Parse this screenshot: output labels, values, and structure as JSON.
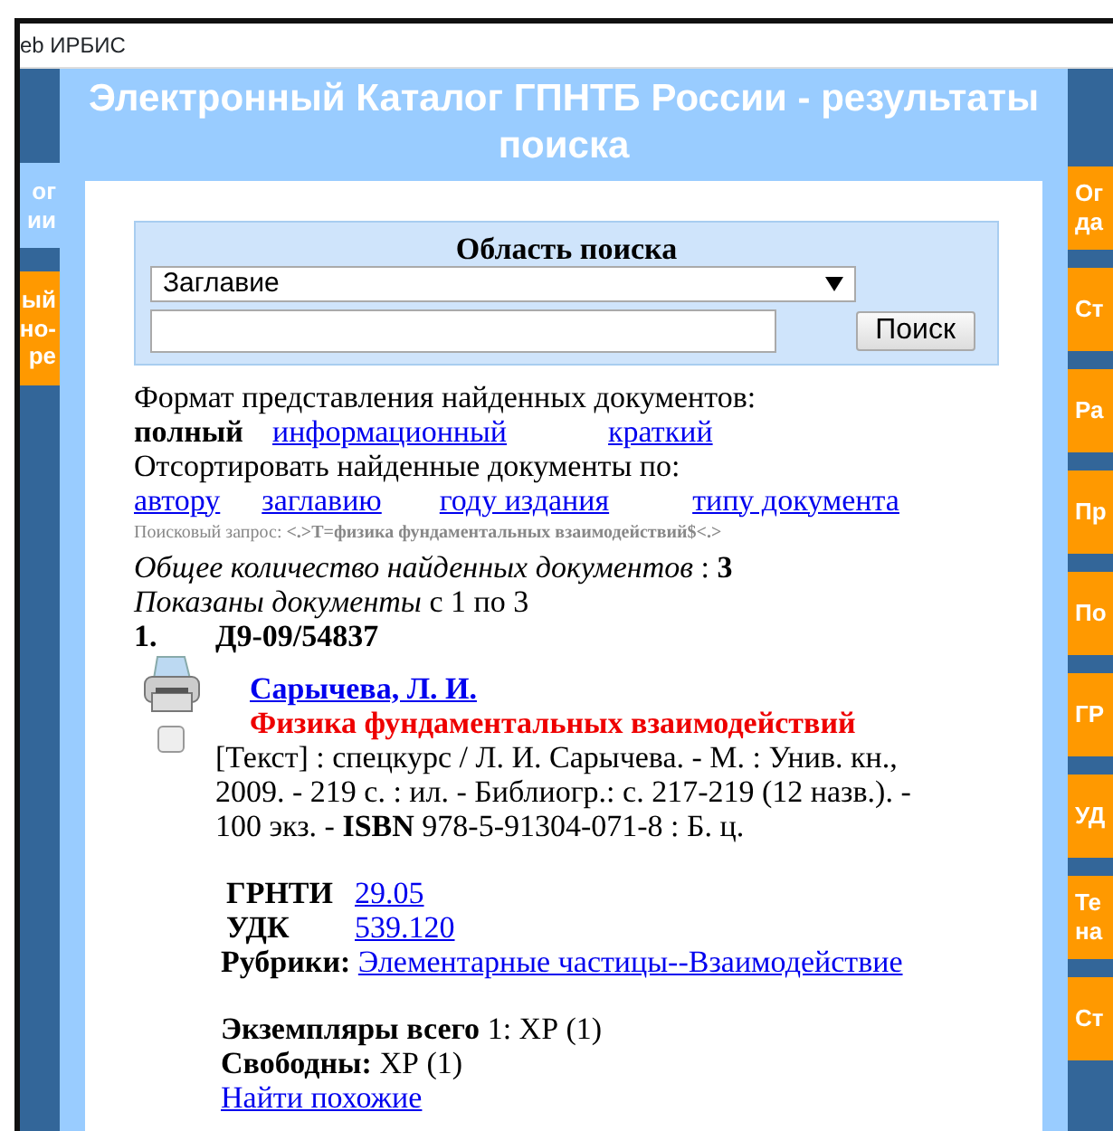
{
  "window": {
    "title": "eb ИРБИС"
  },
  "left_nav": [
    {
      "lines": [
        "ог",
        "ии"
      ],
      "kind": "current"
    },
    {
      "lines": [
        "ый",
        "но-",
        "ре"
      ],
      "kind": "link"
    }
  ],
  "header": {
    "title": "Электронный Каталог ГПНТБ России - результаты поиска"
  },
  "search": {
    "label": "Область поиска",
    "field": "Заглавие",
    "button": "Поиск"
  },
  "format": {
    "label": "Формат представления найденных документов:",
    "options": [
      {
        "text": "полный",
        "selected": true
      },
      {
        "text": "информационный",
        "selected": false
      },
      {
        "text": "краткий",
        "selected": false
      }
    ]
  },
  "sort": {
    "label": "Отсортировать найденные документы по:",
    "options": [
      "автору",
      "заглавию",
      "году издания",
      "типу документа"
    ]
  },
  "query": "Поисковый запрос: **<.>T=физика фундаментальных взаимодействий$<.>**",
  "total": "*Общее количество найденных документов* : **3**",
  "shown": "*Показаны документы* с 1 по 3",
  "records": [
    {
      "number": "1.",
      "code": "Д9-09/54837",
      "checked": false,
      "author": "Сарычева, Л. И.",
      "title": "Физика фундаментальных взаимодействий",
      "description": "[Текст] : спецкурс / Л. И. Сарычева. - М. : Унив. кн., 2009. - 219 с. : ил. - Библиогр.: с. 217-219 (12 назв.). - 100 экз. - **ISBN** 978-5-91304-071-8 : Б. ц.",
      "classes": [
        {
          "label": "ГРНТИ",
          "value": "29.05"
        },
        {
          "label": "УДК",
          "value": "539.120"
        }
      ],
      "rubrics_label": "Рубрики:",
      "rubric": "Элементарные частицы--Взаимодействие",
      "copies": "**Экземпляры всего** 1: ХР (1)",
      "free": "**Свободны:** ХР (1)",
      "similar": "Найти похожие"
    }
  ],
  "right_nav": [
    {
      "lines": [
        "Ог",
        "да"
      ]
    },
    {
      "lines": [
        "Ст"
      ]
    },
    {
      "lines": [
        "Ра"
      ]
    },
    {
      "lines": [
        "Пр"
      ]
    },
    {
      "lines": [
        "По"
      ]
    },
    {
      "lines": [
        "ГР"
      ]
    },
    {
      "lines": [
        "УД"
      ]
    },
    {
      "lines": [
        "Те",
        "на"
      ]
    },
    {
      "lines": [
        "Ст"
      ]
    }
  ]
}
